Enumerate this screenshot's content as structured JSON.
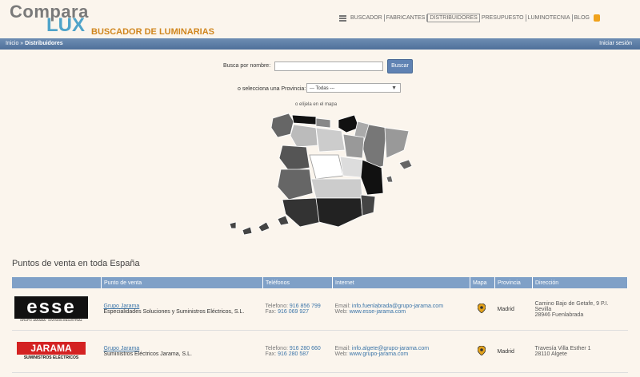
{
  "brand": {
    "top": "Compara",
    "bottom": "LUX",
    "subtitle": "BUSCADOR DE LUMINARIAS"
  },
  "nav": {
    "items": [
      "BUSCADOR",
      "FABRICANTES",
      "DISTRIBUIDORES",
      "PRESUPUESTO",
      "LUMINOTECNIA",
      "BLOG"
    ],
    "active": "DISTRIBUIDORES"
  },
  "breadcrumb": {
    "home": "Inicio",
    "separator": "»",
    "current": "Distribuidores"
  },
  "login": "Iniciar sesión",
  "search": {
    "label": "Busca por nombre:",
    "value": "",
    "button": "Buscar"
  },
  "province": {
    "label": "o selecciona una Provincia:",
    "selected": "--- Todas ---"
  },
  "map_label": "o elíjela en el mapa",
  "section_title": "Puntos de venta en toda España",
  "table": {
    "headers": [
      "Punto de venta",
      "Teléfonos",
      "Internet",
      "Mapa",
      "Provincia",
      "Dirección"
    ],
    "rows": [
      {
        "logo": "esse",
        "logo_sub": "GRUPO JARAMA · DIVISIÓN INDUSTRIAL",
        "name": "Grupo Jarama",
        "desc": "Especialidades Soluciones y Suministros Eléctricos, S.L.",
        "tel_label": "Telefono:",
        "tel": "916 856 799",
        "fax_label": "Fax:",
        "fax": "916 069 927",
        "email_label": "Email:",
        "email": "info.fuenlabrada@grupo-jarama.com",
        "web_label": "Web:",
        "web": "www.esse-jarama.com",
        "province": "Madrid",
        "address1": "Camino Bajo de Getafe, 9 P.I. Sevilla",
        "address2": "28946 Fuenlabrada"
      },
      {
        "logo": "JARAMA",
        "logo_sub": "SUMINISTROS ELÉCTRICOS",
        "name": "Grupo Jarama",
        "desc": "Suministros Eléctricos Jarama, S.L.",
        "tel_label": "Telefono:",
        "tel": "916 280 660",
        "fax_label": "Fax:",
        "fax": "916 280 587",
        "email_label": "Email:",
        "email": "info.algete@grupo-jarama.com",
        "web_label": "Web:",
        "web": "www.grupo-jarama.com",
        "province": "Madrid",
        "address1": "Travesía Villa Esther 1",
        "address2": "28110 Algete"
      }
    ]
  }
}
